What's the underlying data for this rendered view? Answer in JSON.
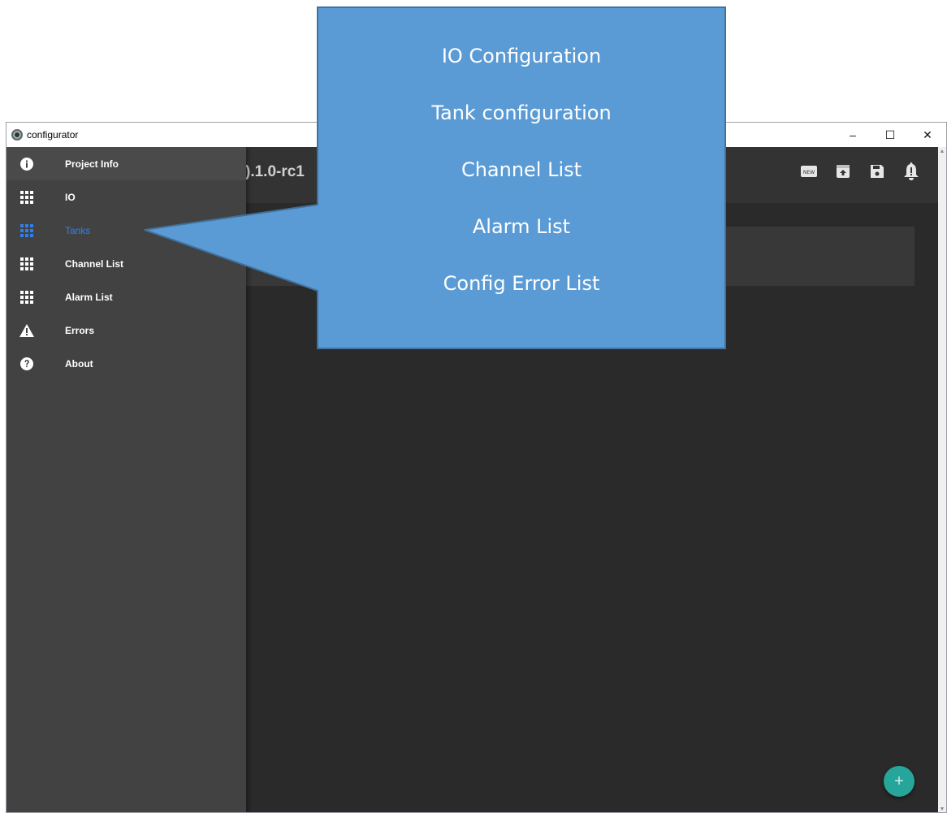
{
  "window": {
    "title": "configurator",
    "minimize": "–",
    "maximize": "☐",
    "close": "✕"
  },
  "appbar": {
    "title_fragment": ").1.0-rc1",
    "actions": [
      {
        "name": "new-project",
        "icon": "new-icon",
        "label": "NEW"
      },
      {
        "name": "open-project",
        "icon": "archive-icon"
      },
      {
        "name": "save-project",
        "icon": "save-icon"
      },
      {
        "name": "alerts",
        "icon": "bell-alert-icon"
      }
    ]
  },
  "drawer": {
    "items": [
      {
        "label": "Project Info",
        "icon": "info-icon"
      },
      {
        "label": "IO",
        "icon": "grid-icon"
      },
      {
        "label": "Tanks",
        "icon": "grid-icon",
        "selected": true
      },
      {
        "label": "Channel List",
        "icon": "grid-icon"
      },
      {
        "label": "Alarm List",
        "icon": "grid-icon"
      },
      {
        "label": "Errors",
        "icon": "warning-icon"
      },
      {
        "label": "About",
        "icon": "help-icon"
      }
    ]
  },
  "fab": {
    "label": "+"
  },
  "callout": {
    "lines": [
      "IO Configuration",
      "Tank configuration",
      "Channel List",
      "Alarm List",
      "Config Error List"
    ]
  },
  "colors": {
    "drawer_bg": "#424242",
    "appbar_bg": "#333333",
    "content_bg": "#2a2a2a",
    "selected_text": "#2f80ed",
    "fab": "#26a69a",
    "callout_fill": "#5b9bd5",
    "callout_border": "#41719c"
  }
}
